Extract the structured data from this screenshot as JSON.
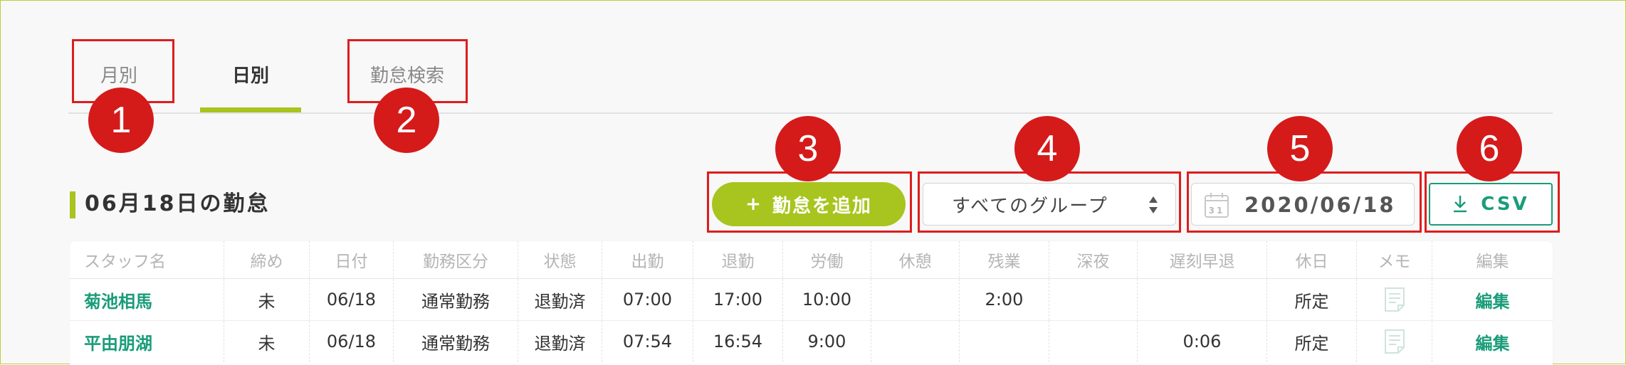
{
  "tabs": [
    {
      "label": "月別",
      "active": false
    },
    {
      "label": "日別",
      "active": true
    },
    {
      "label": "勤怠検索",
      "active": false
    }
  ],
  "markers": [
    "1",
    "2",
    "3",
    "4",
    "5",
    "6"
  ],
  "heading": "06月18日の勤怠",
  "toolbar": {
    "add_label": "勤怠を追加",
    "add_icon": "+",
    "group_select": "すべてのグループ",
    "date_value": "2020/06/18",
    "calendar_day": "31",
    "csv_label": "CSV"
  },
  "table": {
    "headers": [
      "スタッフ名",
      "締め",
      "日付",
      "勤務区分",
      "状態",
      "出勤",
      "退勤",
      "労働",
      "休憩",
      "残業",
      "深夜",
      "遅刻早退",
      "休日",
      "メモ",
      "編集"
    ],
    "rows": [
      {
        "name": "菊池相馬",
        "closing": "未",
        "date": "06/18",
        "category": "通常勤務",
        "status": "退勤済",
        "clock_in": "07:00",
        "clock_out": "17:00",
        "work": "10:00",
        "break": "",
        "overtime": "2:00",
        "night": "",
        "late_early": "",
        "holiday": "所定",
        "edit": "編集"
      },
      {
        "name": "平由朋湖",
        "closing": "未",
        "date": "06/18",
        "category": "通常勤務",
        "status": "退勤済",
        "clock_in": "07:54",
        "clock_out": "16:54",
        "work": "9:00",
        "break": "",
        "overtime": "",
        "night": "",
        "late_early": "0:06",
        "holiday": "所定",
        "edit": "編集"
      }
    ]
  },
  "colors": {
    "accent_green": "#a8c41e",
    "teal": "#1a9c7a",
    "annotation_red": "#dd1d1d"
  }
}
